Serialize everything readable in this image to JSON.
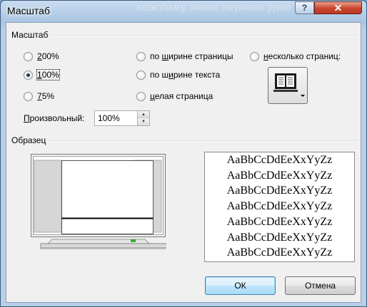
{
  "window": {
    "title": "Масштаб",
    "title_overlay": "каждому меню первого уров",
    "help_label": "?",
    "close_label": "✕"
  },
  "zoom_group": {
    "label": "Масштаб",
    "options": [
      {
        "pre": "",
        "u": "2",
        "post": "00%",
        "selected": false
      },
      {
        "pre": "",
        "u": "1",
        "post": "00%",
        "selected": true
      },
      {
        "pre": "",
        "u": "7",
        "post": "5%",
        "selected": false
      }
    ],
    "fit_options": [
      {
        "pre": "по ",
        "u": "ш",
        "post": "ирине страницы",
        "selected": false
      },
      {
        "pre": "по ш",
        "u": "и",
        "post": "рине текста",
        "selected": false
      },
      {
        "pre": "",
        "u": "ц",
        "post": "елая страница",
        "selected": false
      }
    ],
    "multi_page": {
      "pre": "",
      "u": "н",
      "post": "есколько страниц:",
      "selected": false
    },
    "custom_label_pre": "",
    "custom_label_u": "П",
    "custom_label_post": "роизвольный:",
    "custom_value": "100%"
  },
  "preview_group": {
    "label": "Образец",
    "sample_lines": [
      "AaBbCcDdEeXxYyZz",
      "AaBbCcDdEeXxYyZz",
      "AaBbCcDdEeXxYyZz",
      "AaBbCcDdEeXxYyZz",
      "AaBbCcDdEeXxYyZz",
      "AaBbCcDdEeXxYyZz",
      "AaBbCcDdEeXxYyZz"
    ]
  },
  "buttons": {
    "ok": "ОК",
    "cancel": "Отмена"
  },
  "icons": {
    "help": "help-icon",
    "close": "close-icon",
    "multi_page": "monitor-pages-icon",
    "spin_up": "spin-up-icon",
    "spin_down": "spin-down-icon"
  }
}
